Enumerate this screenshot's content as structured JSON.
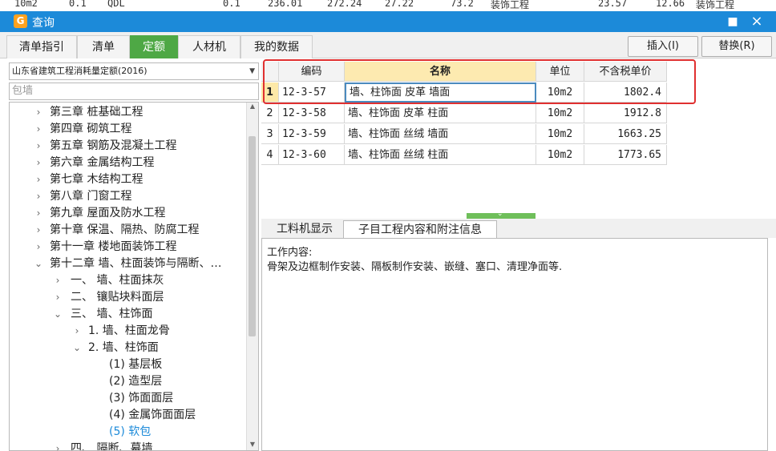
{
  "background_strip": {
    "cells": [
      "10m2",
      "0.1",
      "QDL",
      "0.1",
      "236.01",
      "272.24",
      "27.22",
      "73.2",
      "装饰工程",
      "23.57",
      "12.66",
      "装饰工程"
    ]
  },
  "window": {
    "title": "查询",
    "icon": "app-icon",
    "pin_icon": "■",
    "close_icon": "×"
  },
  "tabs": [
    {
      "label": "清单指引",
      "active": false
    },
    {
      "label": "清单",
      "active": false
    },
    {
      "label": "定额",
      "active": true
    },
    {
      "label": "人材机",
      "active": false
    },
    {
      "label": "我的数据",
      "active": false
    }
  ],
  "actions": {
    "insert_label": "插入(I)",
    "replace_label": "替换(R)"
  },
  "library": {
    "selected": "山东省建筑工程消耗量定额(2016)"
  },
  "search": {
    "placeholder": "包墙"
  },
  "tree": [
    {
      "label": "第三章 桩基础工程",
      "chev": "›"
    },
    {
      "label": "第四章 砌筑工程",
      "chev": "›"
    },
    {
      "label": "第五章 钢筋及混凝土工程",
      "chev": "›"
    },
    {
      "label": "第六章 金属结构工程",
      "chev": "›"
    },
    {
      "label": "第七章 木结构工程",
      "chev": "›"
    },
    {
      "label": "第八章 门窗工程",
      "chev": "›"
    },
    {
      "label": "第九章 屋面及防水工程",
      "chev": "›"
    },
    {
      "label": "第十章 保温、隔热、防腐工程",
      "chev": "›"
    },
    {
      "label": "第十一章 楼地面装饰工程",
      "chev": "›"
    },
    {
      "label": "第十二章 墙、柱面装饰与隔断、…",
      "chev": "⌄"
    },
    {
      "label": "一、 墙、柱面抹灰",
      "chev": "›"
    },
    {
      "label": "二、 镶贴块料面层",
      "chev": "›"
    },
    {
      "label": "三、 墙、柱饰面",
      "chev": "⌄"
    },
    {
      "label": "1. 墙、柱面龙骨",
      "chev": "›"
    },
    {
      "label": "2. 墙、柱饰面",
      "chev": "⌄"
    },
    {
      "label": "(1) 基层板",
      "chev": ""
    },
    {
      "label": "(2) 造型层",
      "chev": ""
    },
    {
      "label": "(3) 饰面面层",
      "chev": ""
    },
    {
      "label": "(4) 金属饰面面层",
      "chev": ""
    },
    {
      "label": "(5) 软包",
      "chev": "",
      "selected": true
    },
    {
      "label": "四、 隔断、幕墙",
      "chev": "›"
    }
  ],
  "table": {
    "headers": {
      "code": "编码",
      "name": "名称",
      "unit": "单位",
      "price": "不含税单价"
    },
    "rows": [
      {
        "num": "1",
        "code": "12-3-57",
        "name": "墙、柱饰面 皮革 墙面",
        "unit": "10m2",
        "price": "1802.4"
      },
      {
        "num": "2",
        "code": "12-3-58",
        "name": "墙、柱饰面 皮革 柱面",
        "unit": "10m2",
        "price": "1912.8"
      },
      {
        "num": "3",
        "code": "12-3-59",
        "name": "墙、柱饰面 丝绒 墙面",
        "unit": "10m2",
        "price": "1663.25"
      },
      {
        "num": "4",
        "code": "12-3-60",
        "name": "墙、柱饰面 丝绒 柱面",
        "unit": "10m2",
        "price": "1773.65"
      }
    ]
  },
  "subtabs": [
    {
      "label": "工料机显示",
      "active": false
    },
    {
      "label": "子目工程内容和附注信息",
      "active": true
    }
  ],
  "content": {
    "heading": "工作内容:",
    "body": "骨架及边框制作安装、隔板制作安装、嵌缝、塞口、清理净面等."
  },
  "colors": {
    "titlebar": "#1c8ad9",
    "active_tab": "#4ea845",
    "highlight": "#e03030",
    "selected_tree": "#1c8ad9"
  }
}
